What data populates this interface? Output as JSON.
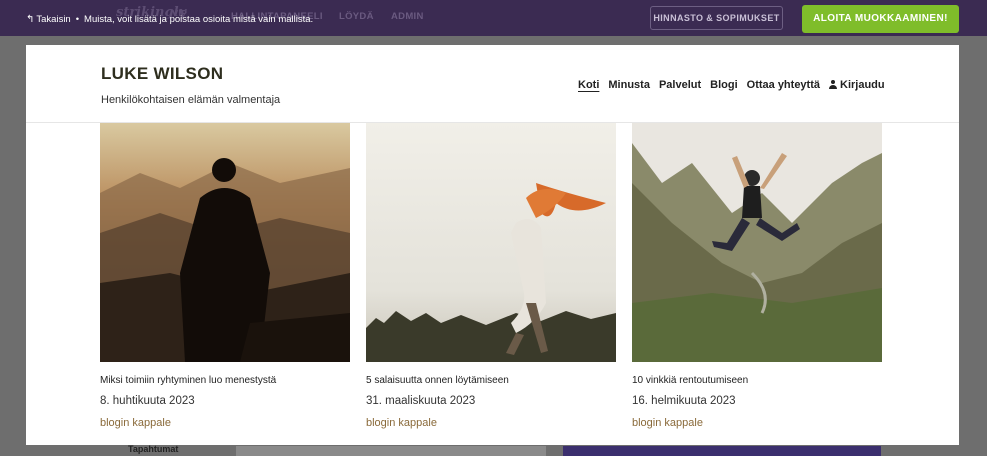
{
  "editor_bar": {
    "back_label": "Takaisin",
    "bullet": "•",
    "notice": "Muista, voit lisätä ja poistaa osioita mistä vain mallista.",
    "brand": "strikingly",
    "brand_suffix": "VIP",
    "nav": [
      "HALLINTAPANEELI",
      "LÖYDÄ",
      "ADMIN"
    ],
    "pricing_button": "HINNASTO & SOPIMUKSET",
    "start_button": "ALOITA MUOKKAAMINEN!"
  },
  "site": {
    "title": "LUKE WILSON",
    "subtitle": "Henkilökohtaisen elämän valmentaja",
    "nav": [
      {
        "label": "Koti",
        "active": true
      },
      {
        "label": "Minusta"
      },
      {
        "label": "Palvelut"
      },
      {
        "label": "Blogi"
      },
      {
        "label": "Ottaa yhteyttä"
      },
      {
        "label": "Kirjaudu",
        "icon": "user-icon"
      }
    ]
  },
  "posts": [
    {
      "title": "Miksi toimiin ryhtyminen luo menestystä",
      "date": "8. huhtikuuta 2023",
      "category": "blogin kappale"
    },
    {
      "title": "5 salaisuutta onnen löytämiseen",
      "date": "31. maaliskuuta 2023",
      "category": "blogin kappale"
    },
    {
      "title": "10 vinkkiä rentoutumiseen",
      "date": "16. helmikuuta 2023",
      "category": "blogin kappale"
    }
  ],
  "background": {
    "section_label": "Tapahtumat"
  },
  "colors": {
    "topbar": "#3b2b52",
    "accent_green": "#7fbd2a",
    "category_link": "#8a6a3a"
  }
}
